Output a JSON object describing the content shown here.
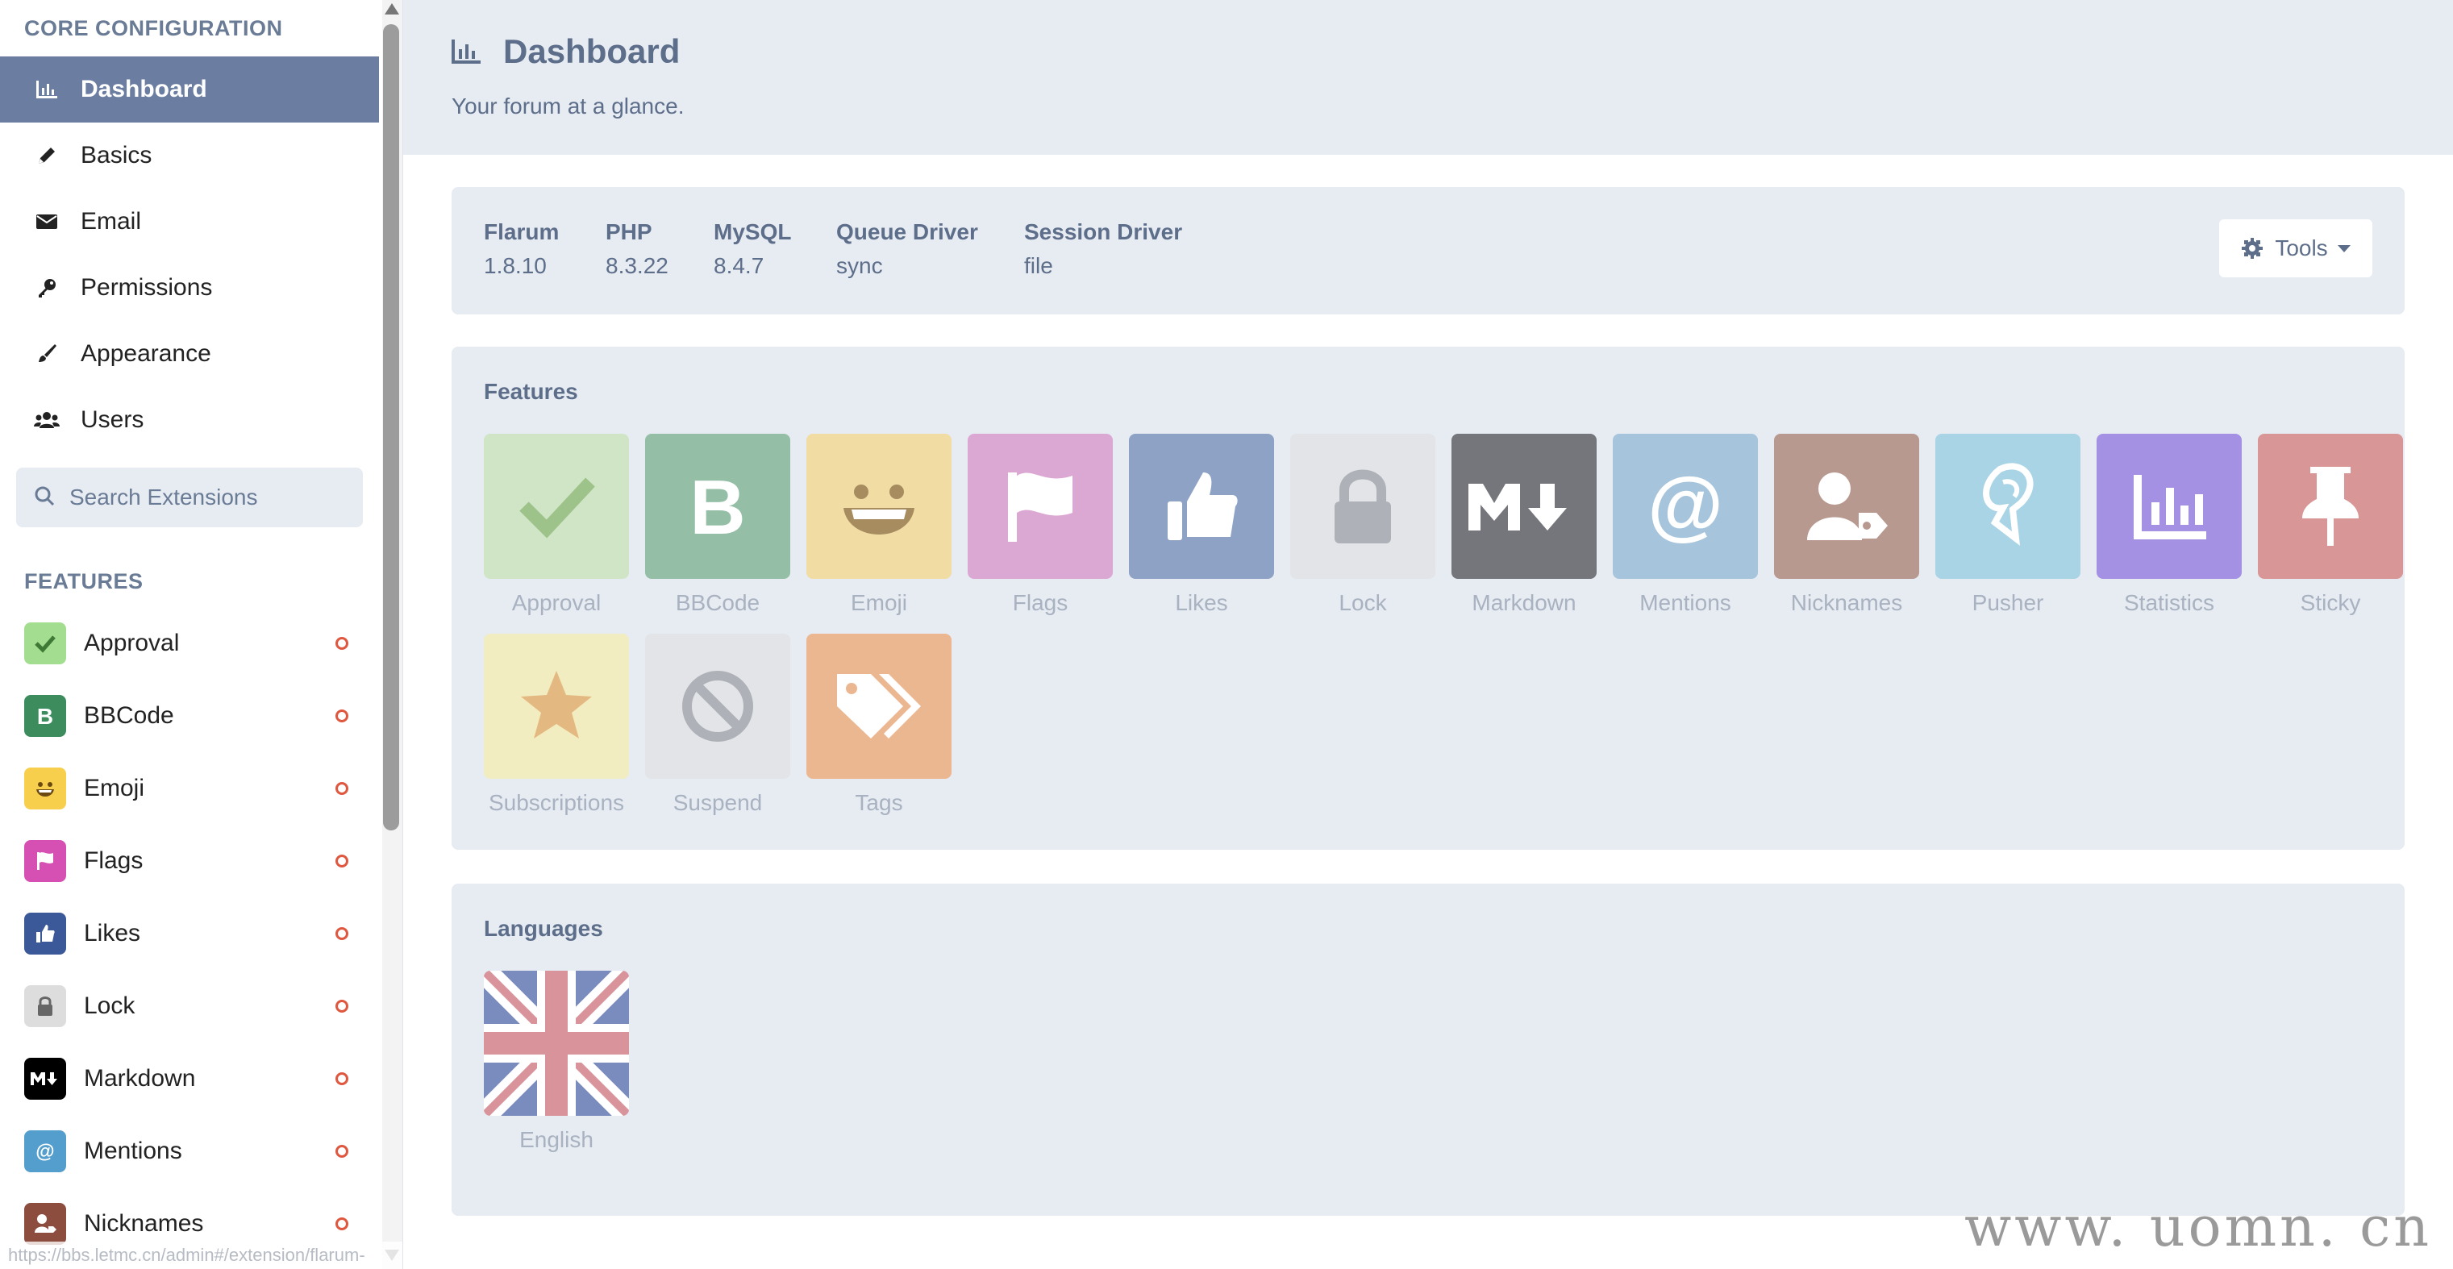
{
  "sidebar": {
    "core_heading": "CORE CONFIGURATION",
    "nav": [
      {
        "label": "Dashboard",
        "icon": "bar-chart-icon",
        "active": true
      },
      {
        "label": "Basics",
        "icon": "pencil-icon"
      },
      {
        "label": "Email",
        "icon": "envelope-icon"
      },
      {
        "label": "Permissions",
        "icon": "key-icon"
      },
      {
        "label": "Appearance",
        "icon": "paintbrush-icon"
      },
      {
        "label": "Users",
        "icon": "users-icon"
      }
    ],
    "search_placeholder": "Search Extensions",
    "features_heading": "FEATURES",
    "extensions": [
      {
        "label": "Approval",
        "color": "#a3dd8f"
      },
      {
        "label": "BBCode",
        "color": "#3c8c5e"
      },
      {
        "label": "Emoji",
        "color": "#f7cf4c"
      },
      {
        "label": "Flags",
        "color": "#d64fb2"
      },
      {
        "label": "Likes",
        "color": "#3b5998"
      },
      {
        "label": "Lock",
        "color": "#dddddd"
      },
      {
        "label": "Markdown",
        "color": "#000000"
      },
      {
        "label": "Mentions",
        "color": "#539ecc"
      },
      {
        "label": "Nicknames",
        "color": "#8c4c3e"
      }
    ],
    "status_url": "https://bbs.letmc.cn/admin#/extension/flarum-lock"
  },
  "header": {
    "title": "Dashboard",
    "subtitle": "Your forum at a glance."
  },
  "info": {
    "items": [
      {
        "label": "Flarum",
        "value": "1.8.10"
      },
      {
        "label": "PHP",
        "value": "8.3.22"
      },
      {
        "label": "MySQL",
        "value": "8.4.7"
      },
      {
        "label": "Queue Driver",
        "value": "sync"
      },
      {
        "label": "Session Driver",
        "value": "file"
      }
    ],
    "tools_label": "Tools"
  },
  "features": {
    "title": "Features",
    "tiles": [
      {
        "name": "Approval",
        "color": "#cfe5c6"
      },
      {
        "name": "BBCode",
        "color": "#94bfa6"
      },
      {
        "name": "Emoji",
        "color": "#f1dca4"
      },
      {
        "name": "Flags",
        "color": "#dba8d3"
      },
      {
        "name": "Likes",
        "color": "#8ea2c6"
      },
      {
        "name": "Lock",
        "color": "#e2e4e8"
      },
      {
        "name": "Markdown",
        "color": "#75767b"
      },
      {
        "name": "Mentions",
        "color": "#a6c4db"
      },
      {
        "name": "Nicknames",
        "color": "#b8998f"
      },
      {
        "name": "Pusher",
        "color": "#a9d4e6"
      },
      {
        "name": "Statistics",
        "color": "#a591e3"
      },
      {
        "name": "Sticky",
        "color": "#d99696"
      },
      {
        "name": "Subscriptions",
        "color": "#f2edc0"
      },
      {
        "name": "Suspend",
        "color": "#e2e4e8"
      },
      {
        "name": "Tags",
        "color": "#ebb791"
      }
    ]
  },
  "languages": {
    "title": "Languages",
    "items": [
      {
        "name": "English"
      }
    ]
  },
  "watermark": "www. uomn. cn"
}
